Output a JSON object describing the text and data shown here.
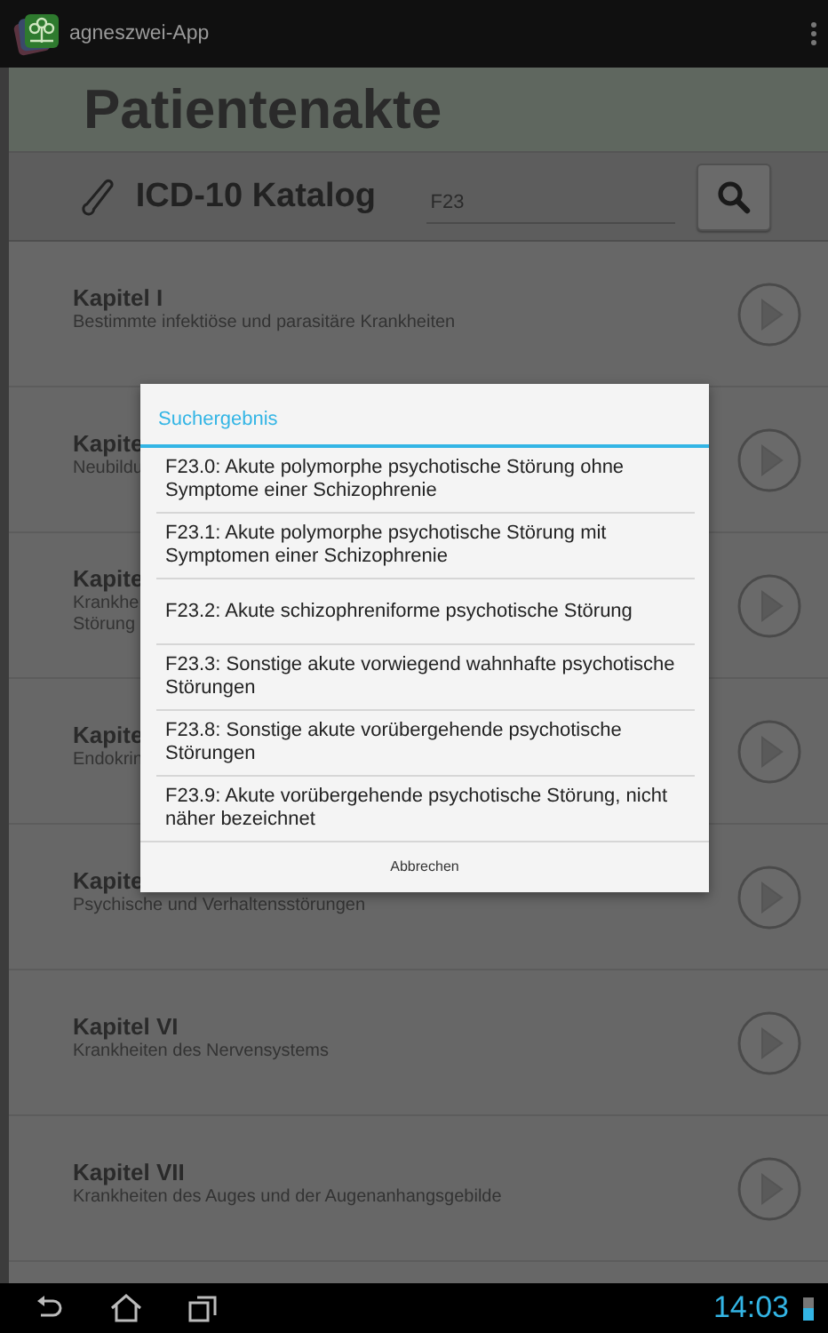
{
  "app_bar": {
    "title": "agneszwei-App"
  },
  "header": {
    "title": "Patientenakte"
  },
  "toolbar": {
    "label": "ICD-10 Katalog",
    "search_value": "F23"
  },
  "chapters": [
    {
      "title": "Kapitel I",
      "subtitle_lines": [
        "Bestimmte infektiöse und parasitäre Krankheiten"
      ]
    },
    {
      "title": "Kapite",
      "subtitle_lines": [
        "Neubildu"
      ]
    },
    {
      "title": "Kapite",
      "subtitle_lines": [
        "Krankhe",
        "Störung"
      ]
    },
    {
      "title": "Kapite",
      "subtitle_lines": [
        "Endokrin"
      ]
    },
    {
      "title": "Kapite",
      "subtitle_lines": [
        "Psychische und Verhaltensstörungen"
      ]
    },
    {
      "title": "Kapitel VI",
      "subtitle_lines": [
        "Krankheiten des Nervensystems"
      ]
    },
    {
      "title": "Kapitel VII",
      "subtitle_lines": [
        "Krankheiten des Auges und der Augenanhangsgebilde"
      ]
    }
  ],
  "dialog": {
    "title": "Suchergebnis",
    "results": [
      "F23.0: Akute polymorphe psychotische Störung ohne Symptome einer Schizophrenie",
      "F23.1: Akute polymorphe psychotische Störung mit Symptomen einer Schizophrenie",
      "F23.2: Akute schizophreniforme psychotische Störung",
      "F23.3: Sonstige akute vorwiegend wahnhafte psychotische Störungen",
      "F23.8: Sonstige akute vorübergehende psychotische Störungen",
      "F23.9: Akute vorübergehende psychotische Störung, nicht näher bezeichnet"
    ],
    "cancel": "Abbrechen"
  },
  "nav_bar": {
    "time": "14:03"
  }
}
